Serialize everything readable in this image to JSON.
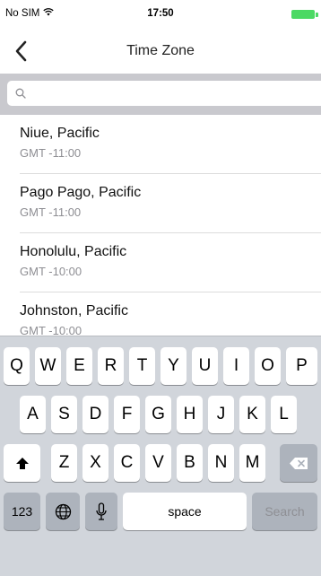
{
  "status_bar": {
    "carrier": "No SIM",
    "time": "17:50"
  },
  "nav": {
    "title": "Time Zone",
    "back_icon": "chevron-left-icon"
  },
  "search": {
    "value": "",
    "placeholder": ""
  },
  "time_zones": [
    {
      "name": "Niue, Pacific",
      "offset": "GMT -11:00"
    },
    {
      "name": "Pago Pago, Pacific",
      "offset": "GMT -11:00"
    },
    {
      "name": "Honolulu, Pacific",
      "offset": "GMT -10:00"
    },
    {
      "name": "Johnston, Pacific",
      "offset": "GMT -10:00"
    }
  ],
  "keyboard": {
    "row1": [
      "Q",
      "W",
      "E",
      "R",
      "T",
      "Y",
      "U",
      "I",
      "O",
      "P"
    ],
    "row2": [
      "A",
      "S",
      "D",
      "F",
      "G",
      "H",
      "J",
      "K",
      "L"
    ],
    "row3": [
      "Z",
      "X",
      "C",
      "V",
      "B",
      "N",
      "M"
    ],
    "numbers_label": "123",
    "space_label": "space",
    "search_label": "Search",
    "icons": {
      "shift": "shift-icon",
      "delete": "delete-icon",
      "globe": "globe-icon",
      "mic": "microphone-icon"
    }
  },
  "colors": {
    "battery": "#4cd964",
    "keyboard_bg": "#d1d5db",
    "search_bar_bg": "#c9c9ce"
  }
}
